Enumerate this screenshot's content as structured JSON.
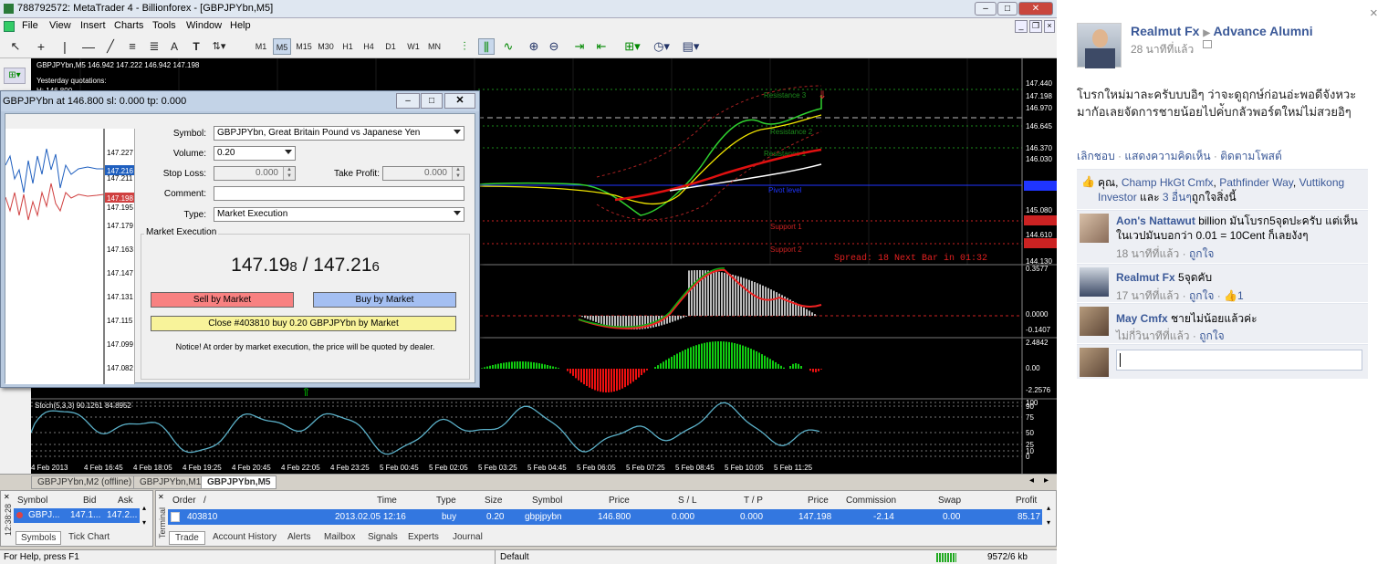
{
  "window": {
    "title": "788792572: MetaTrader 4 - Billionforex - [GBPJPYbn,M5]"
  },
  "menu": [
    "File",
    "View",
    "Insert",
    "Charts",
    "Tools",
    "Window",
    "Help"
  ],
  "toolbar": {
    "timeframes": [
      "M1",
      "M5",
      "M15",
      "M30",
      "H1",
      "H4",
      "D1",
      "W1",
      "MN"
    ]
  },
  "chart": {
    "header": "GBPJPYbn,M5  146.942 147.222 146.942 147.198",
    "yesterday": "Yesterday quotations:",
    "yest_val": "H: 146.800",
    "price_ticks": [
      "147.440",
      "147.198",
      "146.970",
      "146.645",
      "146.370",
      "146.030",
      "145.530",
      "145.080",
      "144.880",
      "144.610",
      "144.130"
    ],
    "levels": [
      "Resistance 3",
      "Resistance 2",
      "Resistance 1",
      "Pivot level",
      "Support 1",
      "Support 2"
    ],
    "spread_text": "Spread: 18  Next Bar in 01:32",
    "osc1_ticks": [
      "0.3577",
      "0.0000",
      "-0.1407"
    ],
    "osc2_ticks": [
      "2.4842",
      "0.00",
      "-2.2576"
    ],
    "stoch_label": "Stoch(5,3,3) 90.1261 84.8952",
    "stoch_ticks": [
      "100",
      "90",
      "75",
      "50",
      "25",
      "10",
      "0"
    ],
    "time_labels": [
      "4 Feb 2013",
      "4 Feb 16:45",
      "4 Feb 18:05",
      "4 Feb 19:25",
      "4 Feb 20:45",
      "4 Feb 22:05",
      "4 Feb 23:25",
      "5 Feb 00:45",
      "5 Feb 02:05",
      "5 Feb 03:25",
      "5 Feb 04:45",
      "5 Feb 06:05",
      "5 Feb 07:25",
      "5 Feb 08:45",
      "5 Feb 10:05",
      "5 Feb 11:25"
    ]
  },
  "chart_tabs": [
    "GBPJPYbn,M2 (offline)",
    "GBPJPYbn,M1",
    "GBPJPYbn,M5"
  ],
  "market_watch": {
    "headers": [
      "Symbol",
      "Bid",
      "Ask"
    ],
    "row": [
      "GBPJ...",
      "147.1...",
      "147.2..."
    ],
    "tabs": [
      "Symbols",
      "Tick Chart"
    ]
  },
  "terminal": {
    "side_label": "Terminal",
    "headers": [
      "Order",
      "Time",
      "Type",
      "Size",
      "Symbol",
      "Price",
      "S / L",
      "T / P",
      "Price",
      "Commission",
      "Swap",
      "Profit"
    ],
    "row": [
      "403810",
      "2013.02.05 12:16",
      "buy",
      "0.20",
      "gbpjpybn",
      "146.800",
      "0.000",
      "0.000",
      "147.198",
      "-2.14",
      "0.00",
      "85.17"
    ],
    "tabs": [
      "Trade",
      "Account History",
      "Alerts",
      "Mailbox",
      "Signals",
      "Experts",
      "Journal"
    ]
  },
  "status": {
    "help": "For Help, press F1",
    "profile": "Default",
    "mem": "9572/6 kb"
  },
  "clock": "12:38:28",
  "dialog": {
    "title": "GBPJPYbn at 146.800 sl: 0.000 tp: 0.000",
    "symbol_label": "Symbol:",
    "symbol": "GBPJPYbn, Great Britain Pound vs Japanese Yen",
    "volume_label": "Volume:",
    "volume": "0.20",
    "sl_label": "Stop Loss:",
    "sl": "0.000",
    "tp_label": "Take Profit:",
    "tp": "0.000",
    "comment_label": "Comment:",
    "comment": "",
    "type_label": "Type:",
    "type": "Market Execution",
    "group": "Market Execution",
    "bid_main": "147.19",
    "bid_small": "8",
    "ask_main": "147.21",
    "ask_small": "6",
    "sep": "/",
    "sell": "Sell by Market",
    "buy": "Buy by Market",
    "close": "Close #403810 buy 0.20 GBPJPYbn by Market",
    "notice": "Notice! At order by market execution, the price will be quoted by dealer.",
    "mini_ticks": [
      "147.227",
      "147.216",
      "147.211",
      "147.198",
      "147.195",
      "147.179",
      "147.163",
      "147.147",
      "147.131",
      "147.115",
      "147.099",
      "147.082"
    ]
  },
  "fb": {
    "author": "Realmut Fx",
    "arrow": "▶",
    "group": "Advance Alumni",
    "time": "28 นาทีที่แล้ว",
    "post": "โบรกใหม่มาละครับบบอิๆ ว่าจะดูฤกษ์ก่อนอ่ะพอดีจังหวะมากัอเลยจัดการชายน้อยไปค่ับกลัวพอร์ตใหม่ไม่สวยอิๆ",
    "actions": [
      "เลิกชอบ",
      "แสดงความคิดเห็น",
      "ติดตามโพสต์"
    ],
    "likes_prefix": "คุณ,",
    "likers": [
      "Champ HkGt Cmfx",
      "Pathfinder Way",
      "Vuttikong Investor"
    ],
    "likes_and": "และ",
    "likes_more": "3 อื่นๆ",
    "likes_suffix": "ถูกใจสิ่งนี้",
    "comments": [
      {
        "name": "Aon's Nattawut",
        "text": "billion มันโบรก5จุดปะครับ แต่เห็นในเวปมันบอกว่า 0.01 = 10Cent ก็เลยงังๆ",
        "time": "18 นาทีที่แล้ว",
        "like": "ถูกใจ"
      },
      {
        "name": "Realmut Fx",
        "text": "5จุดคับ",
        "time": "17 นาทีที่แล้ว",
        "like": "ถูกใจ",
        "likes": "1"
      },
      {
        "name": "May Cmfx",
        "text": "ชายไม่น้อยแล้วค่ะ",
        "time": "ไม่กี่วินาทีที่แล้ว",
        "like": "ถูกใจ"
      }
    ],
    "close": "×"
  }
}
